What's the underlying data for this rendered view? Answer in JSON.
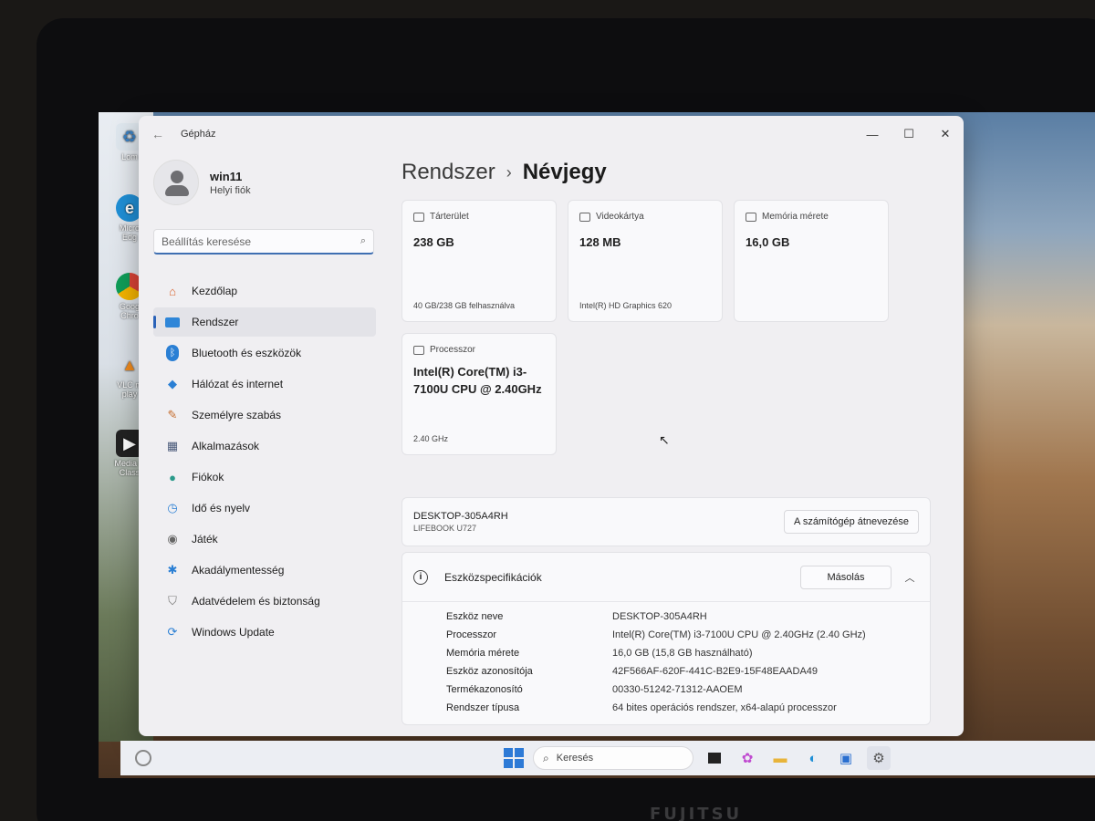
{
  "window": {
    "app_title": "Gépház"
  },
  "user": {
    "name": "win11",
    "account_type": "Helyi fiók"
  },
  "search": {
    "placeholder": "Beállítás keresése"
  },
  "nav": [
    {
      "label": "Kezdőlap",
      "icon": "home-icon"
    },
    {
      "label": "Rendszer",
      "icon": "system-icon",
      "active": true
    },
    {
      "label": "Bluetooth és eszközök",
      "icon": "bluetooth-icon"
    },
    {
      "label": "Hálózat és internet",
      "icon": "wifi-icon"
    },
    {
      "label": "Személyre szabás",
      "icon": "brush-icon"
    },
    {
      "label": "Alkalmazások",
      "icon": "apps-icon"
    },
    {
      "label": "Fiókok",
      "icon": "account-icon"
    },
    {
      "label": "Idő és nyelv",
      "icon": "clock-globe-icon"
    },
    {
      "label": "Játék",
      "icon": "gamepad-icon"
    },
    {
      "label": "Akadálymentesség",
      "icon": "accessibility-icon"
    },
    {
      "label": "Adatvédelem és biztonság",
      "icon": "shield-icon"
    },
    {
      "label": "Windows Update",
      "icon": "update-icon"
    }
  ],
  "breadcrumb": {
    "parent": "Rendszer",
    "separator": "›",
    "current": "Névjegy"
  },
  "cards": {
    "storage": {
      "title": "Tárterület",
      "value": "238 GB",
      "footer": "40 GB/238 GB felhasználva"
    },
    "gpu": {
      "title": "Videokártya",
      "value": "128 MB",
      "footer": "Intel(R) HD Graphics 620"
    },
    "memory": {
      "title": "Memória mérete",
      "value": "16,0 GB",
      "footer": ""
    },
    "cpu": {
      "title": "Processzor",
      "value": "Intel(R) Core(TM) i3-7100U CPU @ 2.40GHz",
      "footer": "2.40 GHz"
    }
  },
  "device": {
    "name": "DESKTOP-305A4RH",
    "model": "LIFEBOOK U727",
    "rename_button": "A számítógép átnevezése"
  },
  "specs": {
    "title": "Eszközspecifikációk",
    "copy_button": "Másolás",
    "rows": [
      {
        "label": "Eszköz neve",
        "value": "DESKTOP-305A4RH"
      },
      {
        "label": "Processzor",
        "value": "Intel(R) Core(TM) i3-7100U CPU @ 2.40GHz (2.40 GHz)"
      },
      {
        "label": "Memória mérete",
        "value": "16,0 GB (15,8 GB használható)"
      },
      {
        "label": "Eszköz azonosítója",
        "value": "42F566AF-620F-441C-B2E9-15F48EAADA49"
      },
      {
        "label": "Termékazonosító",
        "value": "00330-51242-71312-AAOEM"
      },
      {
        "label": "Rendszer típusa",
        "value": "64 bites operációs rendszer, x64-alapú processzor"
      }
    ]
  },
  "taskbar": {
    "search_label": "Keresés"
  },
  "desktop_icons": [
    "Lom",
    "Micro Edg",
    "Goog Chro",
    "VLC m play",
    "Media P Class"
  ],
  "brand": "FUJITSU"
}
